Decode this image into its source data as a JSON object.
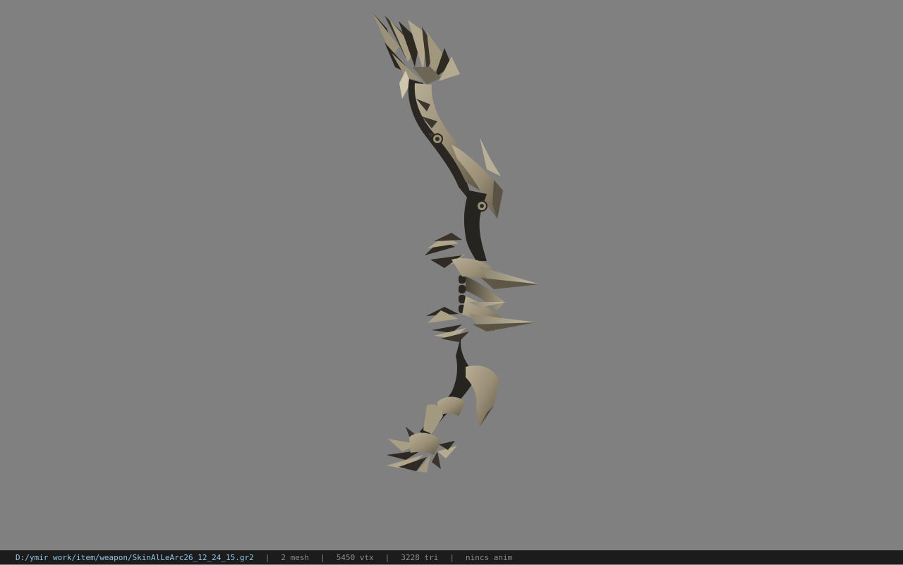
{
  "viewport": {
    "background_color": "#808080",
    "model_name": "bow-model"
  },
  "status_bar": {
    "file_path": "D:/ymir work/item/weapon/SkinAlLeArc26_12_24_15.gr2",
    "separator": "|",
    "mesh_count": "2 mesh",
    "vertex_count": "5450 vtx",
    "triangle_count": "3228 tri",
    "animation": "nincs anim",
    "path_color": "#8ec6e6",
    "stat_color": "#8a8a8a"
  }
}
